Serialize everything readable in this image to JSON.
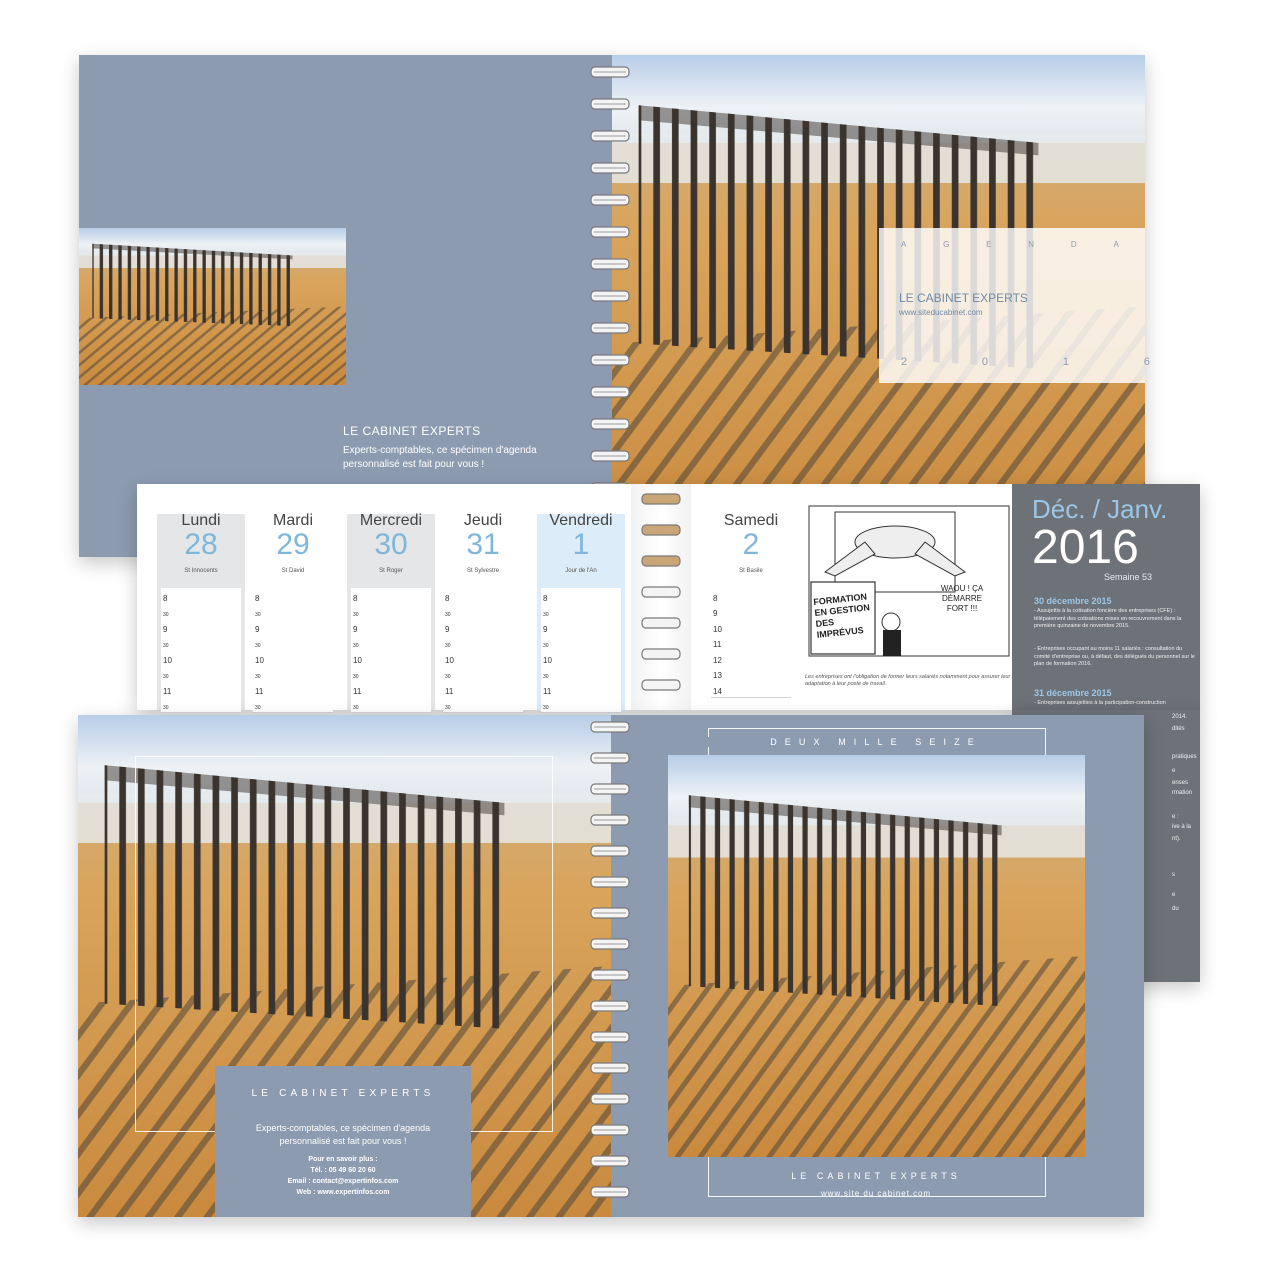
{
  "top_spread": {
    "left_page": {
      "title": "LE CABINET EXPERTS",
      "tagline_line1": "Experts-comptables, ce spécimen d'agenda",
      "tagline_line2": "personnalisé est fait pour vous !"
    },
    "cover_box": {
      "label_agenda": "AGENDA",
      "title": "LE CABINET EXPERTS",
      "website": "www.siteducabinet.com",
      "year": "2016"
    }
  },
  "planner": {
    "days": [
      {
        "name": "Lundi",
        "number": "28",
        "saint": "St Innocents",
        "highlight": "gray"
      },
      {
        "name": "Mardi",
        "number": "29",
        "saint": "St David",
        "highlight": "none"
      },
      {
        "name": "Mercredi",
        "number": "30",
        "saint": "St Roger",
        "highlight": "gray"
      },
      {
        "name": "Jeudi",
        "number": "31",
        "saint": "St Sylvestre",
        "highlight": "none"
      },
      {
        "name": "Vendredi",
        "number": "1",
        "saint": "Jour de l'An",
        "highlight": "blue"
      },
      {
        "name": "Samedi",
        "number": "2",
        "saint": "St Basile",
        "highlight": "none"
      }
    ],
    "hours_weekday": [
      "8",
      "30",
      "9",
      "30",
      "10",
      "30",
      "11",
      "30"
    ],
    "hours_saturday": [
      "8",
      "9",
      "10",
      "11",
      "12",
      "13",
      "14"
    ],
    "cartoon": {
      "board_text": "FORMATION EN GESTION DES IMPRÉVUS",
      "speech": "WAOU ! ÇA DÉMARRE FORT !!!",
      "caption": "Les entreprises ont l'obligation de former leurs salariés notamment pour assurer leur adaptation à leur poste de travail."
    },
    "side_panel": {
      "month": "Déc. / Janv.",
      "year": "2016",
      "week": "Semaine 53",
      "date1": "30 décembre 2015",
      "bullet1": "- Assujettis à la cotisation foncière des entreprises (CFE) : télépaiement des cotisations mises en recouvrement dans la première quinzaine de novembre 2015.",
      "bullet2": "- Entreprises occupant au moins 11 salariés : consultation du comité d'entreprise ou, à défaut, des délégués du personnel sur le plan de formation 2016.",
      "date2": "31 décembre 2015",
      "bullet3": "- Entreprises assujetties à la participation-construction",
      "fragments": [
        "2014.",
        "dités",
        "pratiques",
        "e",
        "enses",
        "rmation",
        "e :",
        "ive à la",
        "nt).",
        "s",
        "e",
        "du"
      ]
    }
  },
  "bottom_spread": {
    "left_box": {
      "title": "LE CABINET EXPERTS",
      "tagline_line1": "Experts-comptables, ce spécimen d'agenda",
      "tagline_line2": "personnalisé est fait pour vous !",
      "info_heading": "Pour en savoir plus :",
      "tel": "Tél. : 05 49 60 20 60",
      "email": "Email : contact@expertinfos.com",
      "web": "Web : www.expertinfos.com"
    },
    "right_page": {
      "top_label": "DEUX MILLE SEIZE",
      "title": "LE CABINET EXPERTS",
      "website": "www.site du cabinet.com"
    }
  },
  "colors": {
    "slate": "#8d9bb0",
    "dark_panel": "#6d7278",
    "accent_blue": "#7eb6dc",
    "panel_heading_blue": "#9cc6e6"
  }
}
